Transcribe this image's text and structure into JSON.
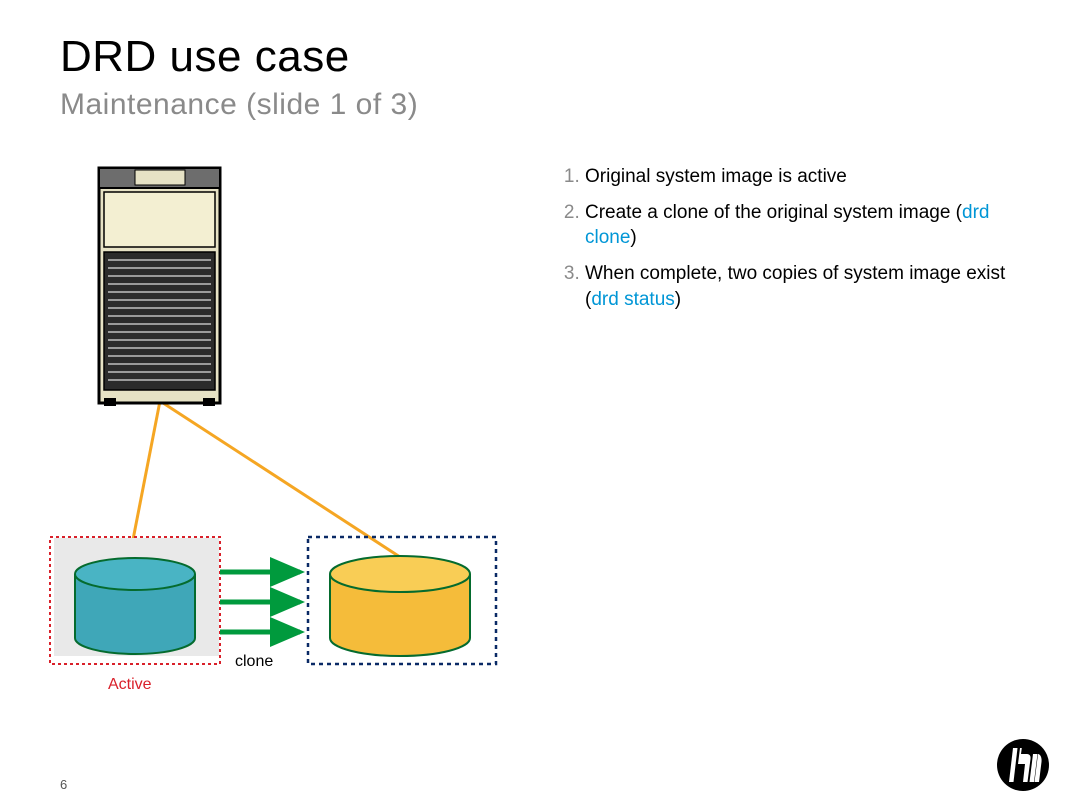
{
  "title": "DRD use case",
  "subtitle": "Maintenance (slide 1 of 3)",
  "page_number": "6",
  "steps": [
    {
      "pre": "Original system image is active",
      "cmd": "",
      "post": ""
    },
    {
      "pre": "Create a clone of the original system image (",
      "cmd": "drd clone",
      "post": ")"
    },
    {
      "pre": "When complete, two copies of system image exist (",
      "cmd": "drd status",
      "post": ")"
    }
  ],
  "labels": {
    "active": "Active",
    "clone": "clone"
  },
  "colors": {
    "accent": "#0096d6",
    "subtitle": "#8a8a8a",
    "active_label": "#d9202a",
    "connector": "#f5a623",
    "arrow": "#009a3d",
    "disk_active": "#3fa7b8",
    "disk_clone": "#f5a623",
    "dashed_active": "#d9202a",
    "dashed_clone": "#003a7a"
  }
}
